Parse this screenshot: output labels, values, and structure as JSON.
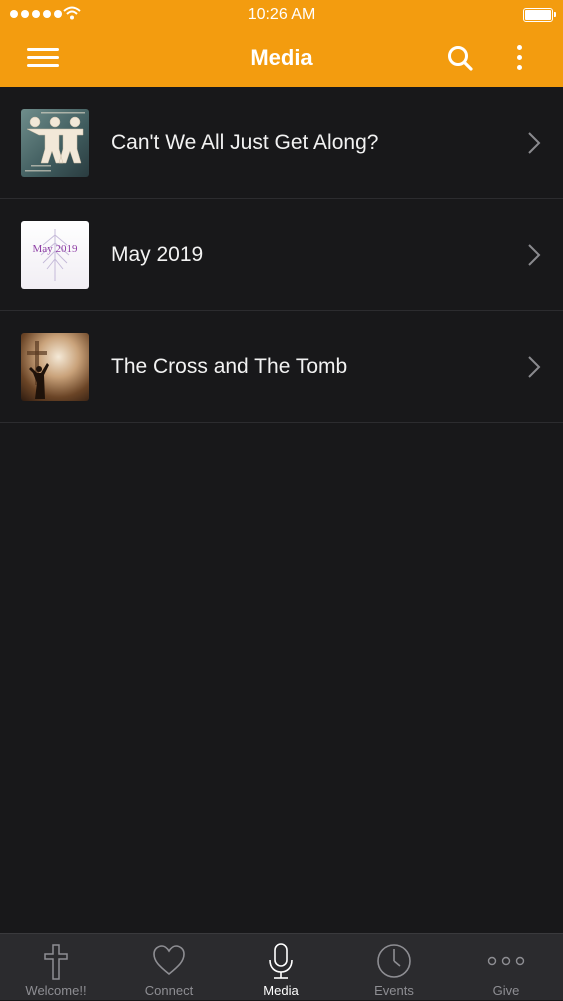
{
  "status_bar": {
    "time": "10:26 AM"
  },
  "nav": {
    "title": "Media"
  },
  "media_list": [
    {
      "label": "Can't We All Just Get Along?"
    },
    {
      "label": "May 2019",
      "thumb_text": "May 2019"
    },
    {
      "label": "The Cross and The Tomb"
    }
  ],
  "tabs": [
    {
      "label": "Welcome!!",
      "icon": "cross-icon"
    },
    {
      "label": "Connect",
      "icon": "heart-icon"
    },
    {
      "label": "Media",
      "icon": "microphone-icon",
      "active": true
    },
    {
      "label": "Events",
      "icon": "clock-icon"
    },
    {
      "label": "Give",
      "icon": "more-dots-icon"
    }
  ],
  "colors": {
    "accent": "#f39c0f",
    "background": "#18181a",
    "tabbar": "#2b2b2e"
  }
}
